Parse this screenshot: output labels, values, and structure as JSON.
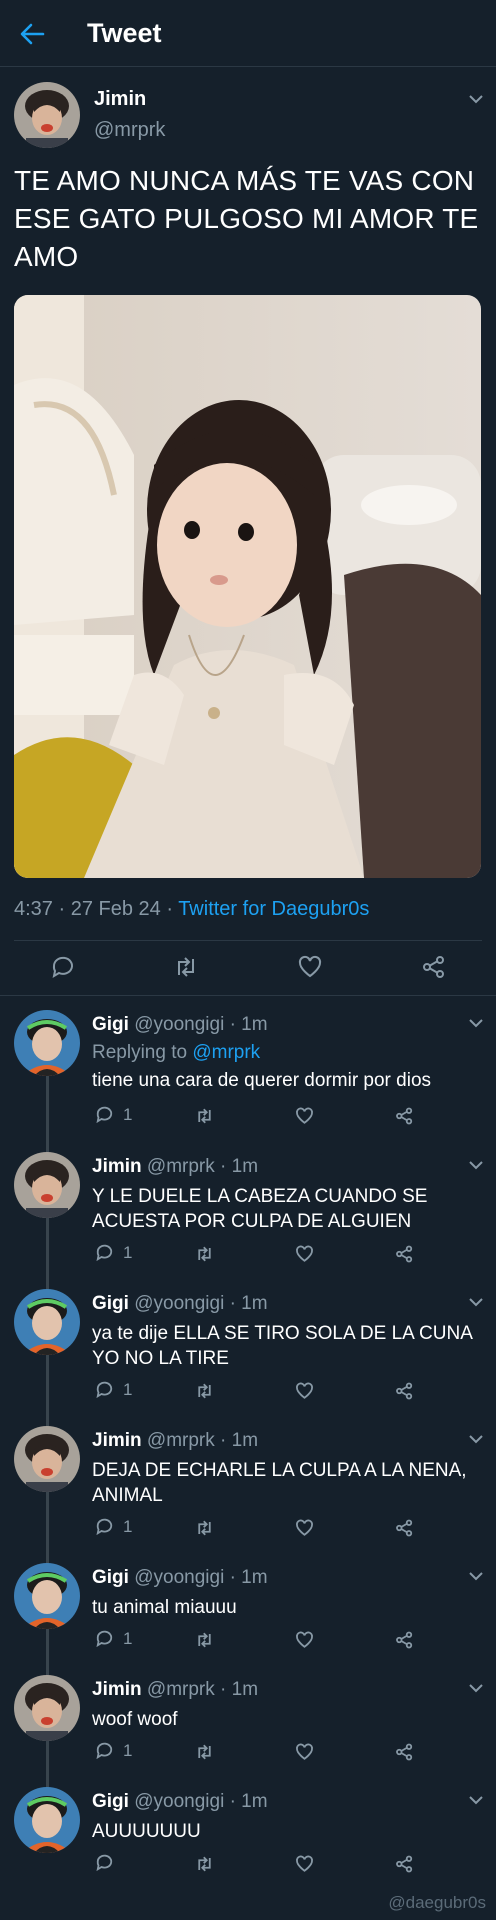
{
  "header": {
    "title": "Tweet"
  },
  "tweet": {
    "name": "Jimin",
    "handle": "@mrprk",
    "text": "TE AMO NUNCA MÁS TE VAS CON ESE GATO PULGOSO MI AMOR TE AMO",
    "time": "4:37 · 27 Feb 24 · ",
    "source": "Twitter for Daegubr0s"
  },
  "replies": [
    {
      "name": "Gigi",
      "handle": "@yoongigi · 1m",
      "replying_label": "Replying to ",
      "replying_to": "@mrprk",
      "text": "tiene una cara de querer dormir por dios",
      "reply_count": "1"
    },
    {
      "name": "Jimin",
      "handle": "@mrprk · 1m",
      "text": "Y LE DUELE LA CABEZA CUANDO SE ACUESTA POR CULPA DE ALGUIEN",
      "reply_count": "1"
    },
    {
      "name": "Gigi",
      "handle": "@yoongigi · 1m",
      "text": "ya te dije ELLA SE TIRO SOLA DE LA CUNA YO NO LA TIRE",
      "reply_count": "1"
    },
    {
      "name": "Jimin",
      "handle": "@mrprk · 1m",
      "text": "DEJA DE ECHARLE LA CULPA A LA NENA, ANIMAL",
      "reply_count": "1"
    },
    {
      "name": "Gigi",
      "handle": "@yoongigi · 1m",
      "text": "tu animal miauuu",
      "reply_count": "1"
    },
    {
      "name": "Jimin",
      "handle": "@mrprk · 1m",
      "text": "woof woof",
      "reply_count": "1"
    },
    {
      "name": "Gigi",
      "handle": "@yoongigi · 1m",
      "text": "AUUUUUUU",
      "reply_count": ""
    }
  ],
  "icons": {
    "back": "arrow-left-icon",
    "caret": "chevron-down-icon",
    "reply": "comment-icon",
    "retweet": "retweet-icon",
    "like": "heart-icon",
    "share": "share-icon"
  },
  "colors": {
    "background": "#15202b",
    "accent": "#1da1f2",
    "muted": "#8899a6",
    "divider": "#2b3844"
  },
  "watermark": "@daegubr0s"
}
